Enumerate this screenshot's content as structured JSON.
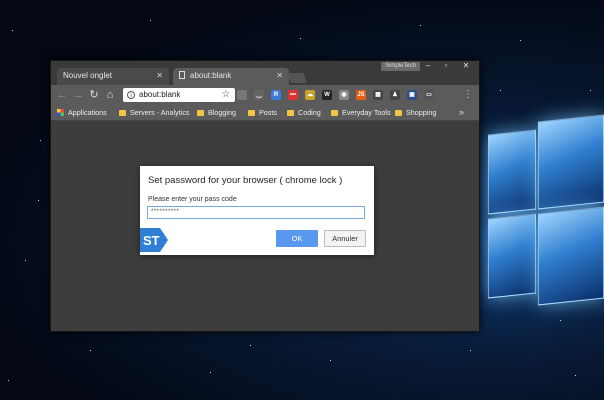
{
  "browser": {
    "profile_label": "SimpleTech",
    "tabs": [
      {
        "label": "Nouvel onglet",
        "active": false
      },
      {
        "label": "about:blank",
        "active": true
      }
    ],
    "toolbar": {
      "url": "about:blank",
      "extensions": [
        {
          "icon": "screen-icon",
          "color": "#777777",
          "text": ""
        },
        {
          "icon": "mustache-icon",
          "color": "#666666",
          "text": "‿"
        },
        {
          "icon": "circle-r-icon",
          "color": "#3b7be0",
          "text": "R"
        },
        {
          "icon": "dots-icon",
          "color": "#d33",
          "text": "•••"
        },
        {
          "icon": "cloud-icon",
          "color": "#c9a227",
          "text": "☁"
        },
        {
          "icon": "w-icon",
          "color": "#222222",
          "text": "W"
        },
        {
          "icon": "sphere-icon",
          "color": "#888888",
          "text": "◉"
        },
        {
          "icon": "js-icon",
          "color": "#e85d10",
          "text": "JS"
        },
        {
          "icon": "grid-icon",
          "color": "#444444",
          "text": "▦"
        },
        {
          "icon": "person-icon",
          "color": "#444444",
          "text": "♟"
        },
        {
          "icon": "screenshot-icon",
          "color": "#2c4f8a",
          "text": "▣"
        },
        {
          "icon": "window-icon",
          "color": "#555555",
          "text": "▭"
        }
      ]
    },
    "bookmarks": [
      {
        "label": "Applications",
        "icon": "apps-icon"
      },
      {
        "label": "Servers - Analytics",
        "icon": "folder-icon"
      },
      {
        "label": "Blogging",
        "icon": "folder-icon"
      },
      {
        "label": "Posts",
        "icon": "folder-icon"
      },
      {
        "label": "Coding",
        "icon": "folder-icon"
      },
      {
        "label": "Everyday Tools",
        "icon": "folder-icon"
      },
      {
        "label": "Shopping",
        "icon": "folder-icon"
      }
    ],
    "more_bookmarks": "»"
  },
  "dialog": {
    "title": "Set password for your browser ( chrome lock )",
    "prompt": "Please enter your pass code",
    "input_value": "**********",
    "ok_label": "OK",
    "cancel_label": "Annuler",
    "logo_text": "ST"
  },
  "colors": {
    "ok_button": "#5a98f0",
    "input_border": "#7aa7e0",
    "chrome_dark": "#3a3a3a"
  }
}
